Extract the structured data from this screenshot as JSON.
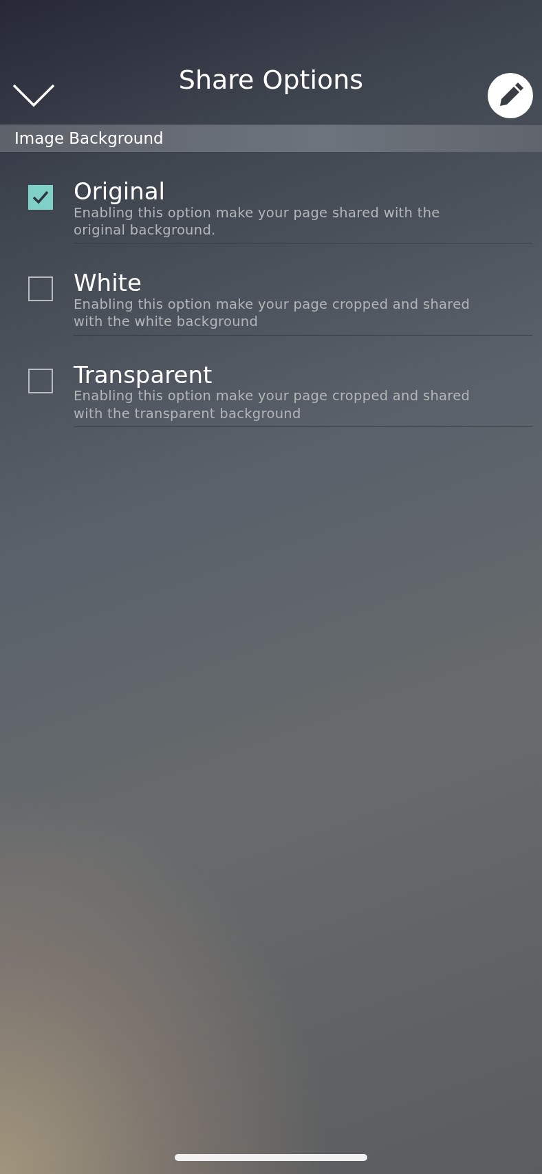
{
  "header": {
    "title": "Share Options"
  },
  "section": {
    "title": "Image Background"
  },
  "options": [
    {
      "label": "Original",
      "description": "Enabling this option make your page shared with the original background.",
      "checked": true
    },
    {
      "label": "White",
      "description": "Enabling this option make your page cropped and shared with the white background",
      "checked": false
    },
    {
      "label": "Transparent",
      "description": "Enabling this option make your page cropped and shared with the transparent background",
      "checked": false
    }
  ]
}
